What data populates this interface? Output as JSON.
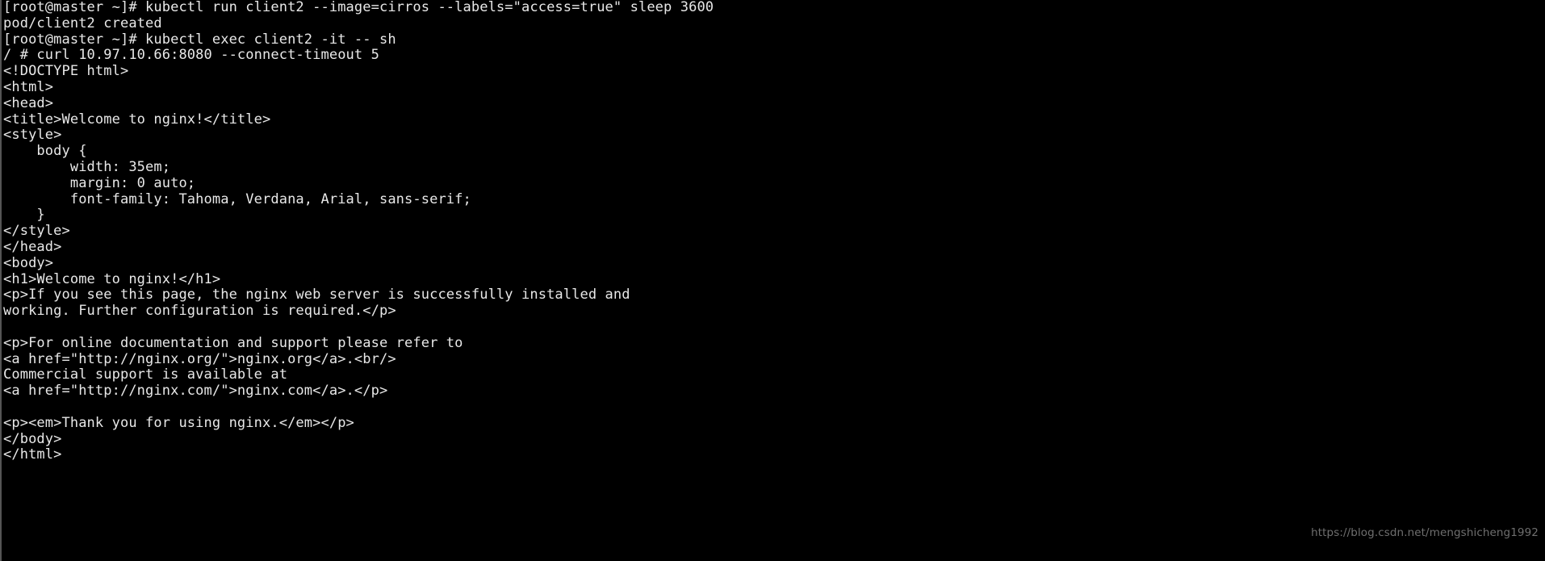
{
  "terminal": {
    "background_color": "#000000",
    "foreground_color": "#e8e8e8",
    "watermark": "https://blog.csdn.net/mengshicheng1992",
    "lines": [
      "[root@master ~]# kubectl run client2 --image=cirros --labels=\"access=true\" sleep 3600",
      "pod/client2 created",
      "[root@master ~]# kubectl exec client2 -it -- sh",
      "/ # curl 10.97.10.66:8080 --connect-timeout 5",
      "<!DOCTYPE html>",
      "<html>",
      "<head>",
      "<title>Welcome to nginx!</title>",
      "<style>",
      "    body {",
      "        width: 35em;",
      "        margin: 0 auto;",
      "        font-family: Tahoma, Verdana, Arial, sans-serif;",
      "    }",
      "</style>",
      "</head>",
      "<body>",
      "<h1>Welcome to nginx!</h1>",
      "<p>If you see this page, the nginx web server is successfully installed and",
      "working. Further configuration is required.</p>",
      "",
      "<p>For online documentation and support please refer to",
      "<a href=\"http://nginx.org/\">nginx.org</a>.<br/>",
      "Commercial support is available at",
      "<a href=\"http://nginx.com/\">nginx.com</a>.</p>",
      "",
      "<p><em>Thank you for using nginx.</em></p>",
      "</body>",
      "</html>"
    ]
  }
}
